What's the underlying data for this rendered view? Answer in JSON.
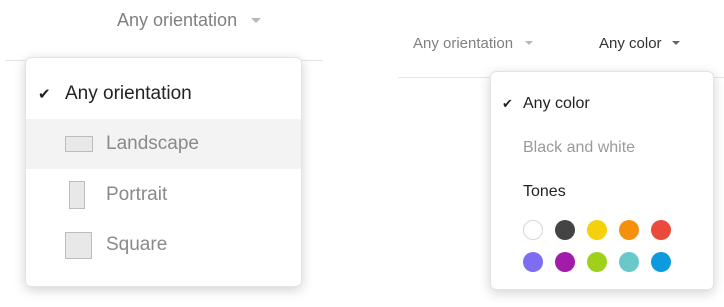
{
  "left": {
    "trigger_label": "Any orientation",
    "menu": {
      "items": [
        {
          "label": "Any orientation",
          "selected": true
        },
        {
          "label": "Landscape",
          "icon": "landscape-icon",
          "hovered": true
        },
        {
          "label": "Portrait",
          "icon": "portrait-icon"
        },
        {
          "label": "Square",
          "icon": "square-icon"
        }
      ]
    }
  },
  "right": {
    "orientation_label": "Any orientation",
    "color_label": "Any color",
    "menu": {
      "any_color": "Any color",
      "black_white": "Black and white",
      "tones_heading": "Tones",
      "swatches": [
        {
          "name": "white",
          "color": "#ffffff"
        },
        {
          "name": "black",
          "color": "#444444"
        },
        {
          "name": "yellow",
          "color": "#f4d10b"
        },
        {
          "name": "orange",
          "color": "#f5900c"
        },
        {
          "name": "red",
          "color": "#ea4a3c"
        },
        {
          "name": "purple",
          "color": "#7d6df0"
        },
        {
          "name": "magenta",
          "color": "#a31ba9"
        },
        {
          "name": "green",
          "color": "#9fd01a"
        },
        {
          "name": "teal",
          "color": "#69c8c8"
        },
        {
          "name": "blue",
          "color": "#0e9ade"
        }
      ]
    }
  }
}
